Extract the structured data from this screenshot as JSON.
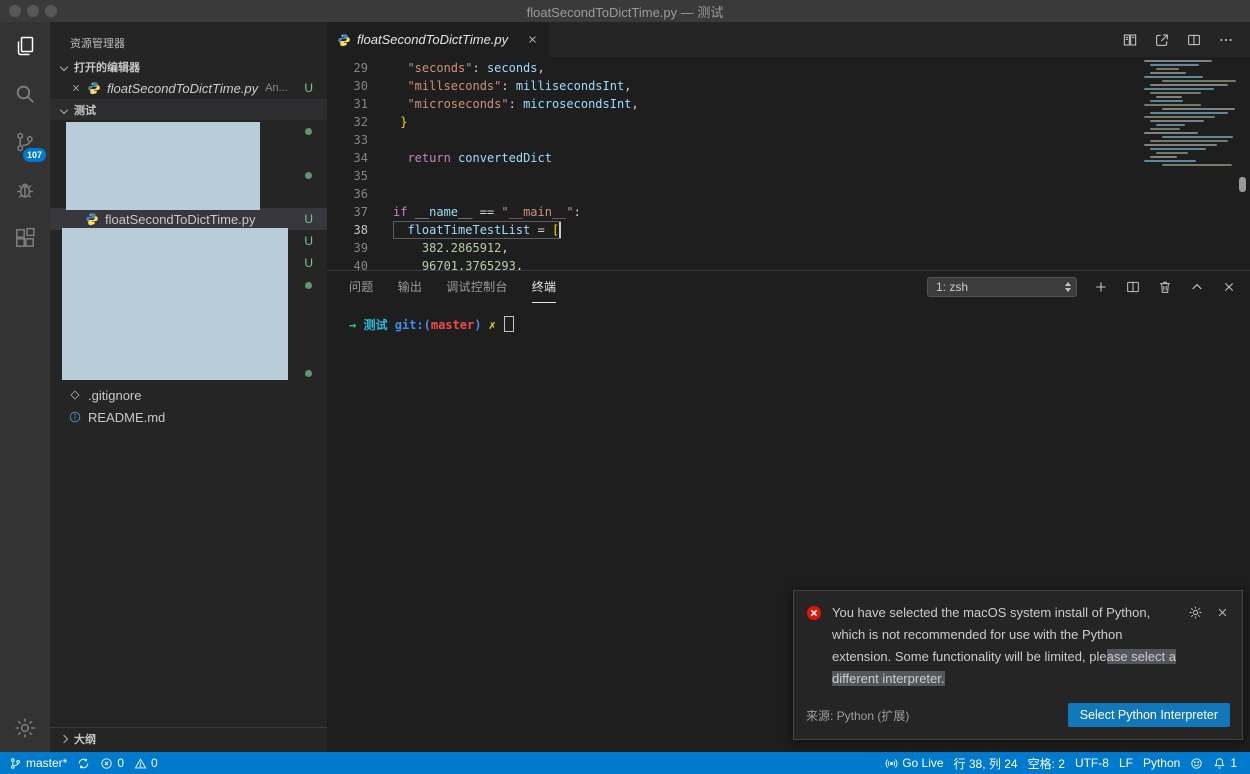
{
  "window": {
    "title": "floatSecondToDictTime.py — 测试"
  },
  "colors": {
    "accent": "#007acc",
    "statusbar": "#007acc",
    "error_red": "#e51400",
    "untracked_green": "#73c991",
    "selection_highlight": "#53575c",
    "button_blue": "#1177bb",
    "redacted_block": "#b9cdd9"
  },
  "activity_bar": {
    "items": [
      {
        "id": "explorer",
        "icon": "files-icon",
        "active": true,
        "badge": ""
      },
      {
        "id": "search",
        "icon": "search-icon",
        "active": false,
        "badge": ""
      },
      {
        "id": "source-control",
        "icon": "source-control-icon",
        "active": false,
        "badge": "107"
      },
      {
        "id": "run-debug",
        "icon": "debug-icon",
        "active": false,
        "badge": ""
      },
      {
        "id": "extensions",
        "icon": "extensions-icon",
        "active": false,
        "badge": ""
      }
    ],
    "bottom_items": [
      {
        "id": "settings",
        "icon": "gear-icon"
      }
    ]
  },
  "sidebar": {
    "title": "资源管理器",
    "open_editors_label": "打开的编辑器",
    "open_editors": [
      {
        "icon": "python-icon",
        "label": "floatSecondToDictTime.py",
        "detail": "An...",
        "git_status": "U"
      }
    ],
    "folder_label": "测试",
    "tree_rows": [
      {
        "type": "redacted",
        "depth": 1,
        "marker": "dot"
      },
      {
        "type": "redacted",
        "depth": 2,
        "marker": ""
      },
      {
        "type": "redacted",
        "depth": 2,
        "marker": "dot"
      },
      {
        "type": "redacted",
        "depth": 2,
        "marker": ""
      },
      {
        "type": "file",
        "depth": 2,
        "icon": "python-icon",
        "label": "floatSecondToDictTime.py",
        "marker": "U",
        "selected": true
      },
      {
        "type": "redacted",
        "depth": 2,
        "marker": "U"
      },
      {
        "type": "redacted",
        "depth": 2,
        "marker": "U"
      },
      {
        "type": "redacted",
        "depth": 1,
        "marker": "dot"
      },
      {
        "type": "redacted",
        "depth": 2,
        "marker": ""
      },
      {
        "type": "redacted",
        "depth": 2,
        "marker": ""
      },
      {
        "type": "redacted",
        "depth": 2,
        "marker": ""
      },
      {
        "type": "redacted",
        "depth": 1,
        "marker": "dot"
      },
      {
        "type": "file",
        "depth": 1,
        "icon": "diamond-icon",
        "label": ".gitignore",
        "marker": ""
      },
      {
        "type": "file",
        "depth": 1,
        "icon": "info-icon",
        "label": "README.md",
        "marker": ""
      }
    ],
    "outline_label": "大纲"
  },
  "editor": {
    "tab": {
      "icon": "python-icon",
      "label": "floatSecondToDictTime.py"
    },
    "actions": [
      {
        "id": "open-changes",
        "icon": "open-changes-icon"
      },
      {
        "id": "open-preview",
        "icon": "open-preview-icon"
      },
      {
        "id": "split-editor",
        "icon": "split-editor-icon"
      },
      {
        "id": "more-actions",
        "icon": "more-actions-icon"
      }
    ],
    "code_lines": [
      {
        "n": 29,
        "segs": [
          [
            "  ",
            "pln"
          ],
          [
            "\"seconds\"",
            "str"
          ],
          [
            ": ",
            "pln"
          ],
          [
            "seconds",
            "var"
          ],
          [
            ",",
            "pln"
          ]
        ]
      },
      {
        "n": 30,
        "segs": [
          [
            "  ",
            "pln"
          ],
          [
            "\"millseconds\"",
            "str"
          ],
          [
            ": ",
            "pln"
          ],
          [
            "millisecondsInt",
            "var"
          ],
          [
            ",",
            "pln"
          ]
        ]
      },
      {
        "n": 31,
        "segs": [
          [
            "  ",
            "pln"
          ],
          [
            "\"microseconds\"",
            "str"
          ],
          [
            ": ",
            "pln"
          ],
          [
            "microsecondsInt",
            "var"
          ],
          [
            ",",
            "pln"
          ]
        ]
      },
      {
        "n": 32,
        "segs": [
          [
            " ",
            "pln"
          ],
          [
            "}",
            "brk"
          ]
        ]
      },
      {
        "n": 33,
        "segs": []
      },
      {
        "n": 34,
        "segs": [
          [
            "  ",
            "pln"
          ],
          [
            "return",
            "kw"
          ],
          [
            " ",
            "pln"
          ],
          [
            "convertedDict",
            "var"
          ]
        ]
      },
      {
        "n": 35,
        "segs": []
      },
      {
        "n": 36,
        "segs": []
      },
      {
        "n": 37,
        "segs": [
          [
            "if",
            "kw"
          ],
          [
            " ",
            "pln"
          ],
          [
            "__name__",
            "var"
          ],
          [
            " == ",
            "pln"
          ],
          [
            "\"__main__\"",
            "str"
          ],
          [
            ":",
            "pln"
          ]
        ]
      },
      {
        "n": 38,
        "current": true,
        "segs": [
          [
            "  ",
            "pln"
          ],
          [
            "floatTimeTestList",
            "var"
          ],
          [
            " = ",
            "pln"
          ],
          [
            "[",
            "brk"
          ]
        ]
      },
      {
        "n": 39,
        "segs": [
          [
            "    ",
            "pln"
          ],
          [
            "382.2865912",
            "num"
          ],
          [
            ",",
            "pln"
          ]
        ]
      },
      {
        "n": 40,
        "segs": [
          [
            "    ",
            "pln"
          ],
          [
            "96701.3765293",
            "num"
          ],
          [
            ",",
            "pln"
          ]
        ]
      }
    ],
    "cursor": {
      "line": 38,
      "col": 24
    }
  },
  "panel": {
    "tabs": [
      {
        "id": "problems",
        "label": "问题",
        "active": false
      },
      {
        "id": "output",
        "label": "输出",
        "active": false
      },
      {
        "id": "debug-console",
        "label": "调试控制台",
        "active": false
      },
      {
        "id": "terminal",
        "label": "终端",
        "active": true
      }
    ],
    "terminal_select": {
      "value": "1: zsh"
    },
    "actions": [
      {
        "id": "new-terminal",
        "icon": "plus-icon"
      },
      {
        "id": "split-terminal",
        "icon": "split-terminal-icon"
      },
      {
        "id": "kill-terminal",
        "icon": "trash-icon"
      },
      {
        "id": "maximize-panel",
        "icon": "chevron-up-icon"
      },
      {
        "id": "close-panel",
        "icon": "close-icon"
      }
    ],
    "prompt": [
      [
        "→",
        "p-arrow"
      ],
      [
        "  ",
        "pln"
      ],
      [
        "测试",
        "p-dir"
      ],
      [
        " ",
        "pln"
      ],
      [
        "git:(",
        "p-git"
      ],
      [
        "master",
        "p-branch"
      ],
      [
        ")",
        "p-git"
      ],
      [
        " ",
        "pln"
      ],
      [
        "✗",
        "p-dirty"
      ]
    ]
  },
  "notification": {
    "severity": "error",
    "message_segments": [
      {
        "text": "You have selected the macOS system install of Python, which is not recommended for use with the Python extension. Some functionality will be limited, ple",
        "highlight": false
      },
      {
        "text": "ase select a different interpreter.",
        "highlight": true
      }
    ],
    "source": "来源: Python (扩展)",
    "button": "Select Python Interpreter"
  },
  "status_bar": {
    "left": [
      {
        "id": "git-branch",
        "icon": "git-branch-icon",
        "label": "master*"
      },
      {
        "id": "sync",
        "icon": "sync-icon",
        "label": ""
      },
      {
        "id": "errors",
        "icon": "error-icon",
        "label": "0"
      },
      {
        "id": "warnings",
        "icon": "warning-icon",
        "label": "0"
      }
    ],
    "right": [
      {
        "id": "go-live",
        "icon": "broadcast-icon",
        "label": "Go Live"
      },
      {
        "id": "cursor-position",
        "label": "行 38, 列 24"
      },
      {
        "id": "indentation",
        "label": "空格: 2"
      },
      {
        "id": "encoding",
        "label": "UTF-8"
      },
      {
        "id": "eol",
        "label": "LF"
      },
      {
        "id": "language-mode",
        "label": "Python"
      },
      {
        "id": "feedback",
        "icon": "smiley-icon",
        "label": ""
      },
      {
        "id": "notifications",
        "icon": "bell-icon",
        "label": "1"
      }
    ]
  }
}
